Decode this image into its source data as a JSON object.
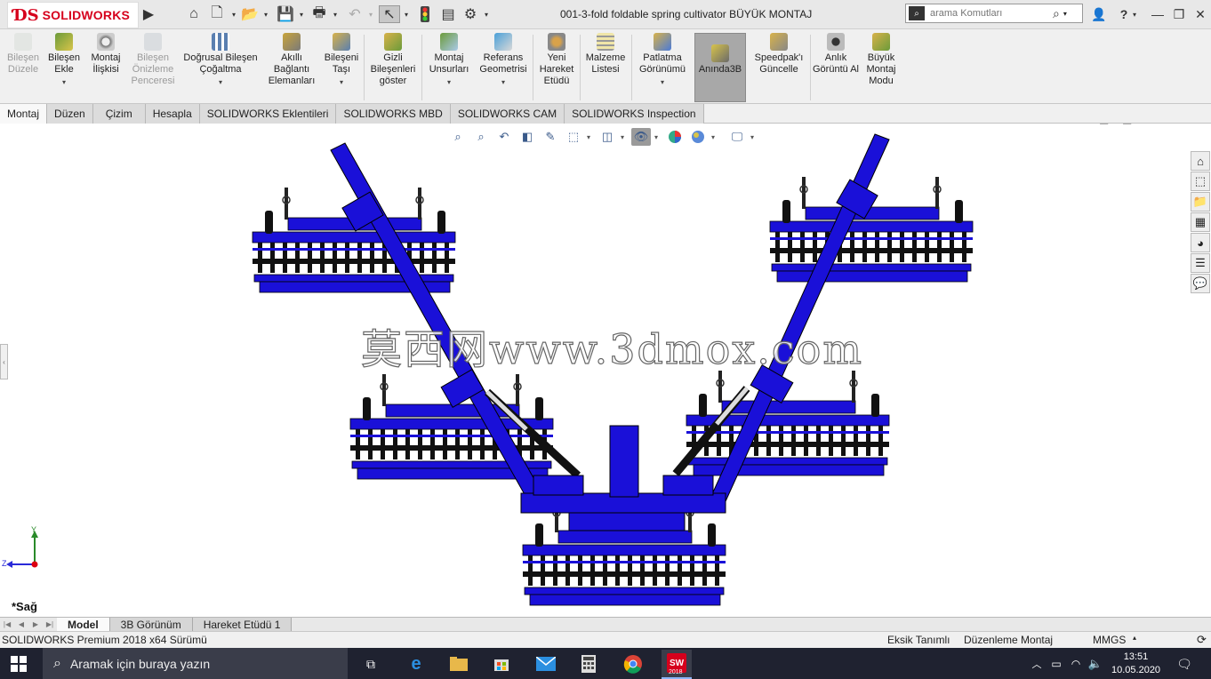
{
  "titlebar": {
    "brand": "SOLIDWORKS",
    "doc_title": "001-3-fold foldable spring cultivator BÜYÜK MONTAJ",
    "search_placeholder": "arama Komutları",
    "help_label": "?"
  },
  "ribbon": {
    "items": [
      {
        "label": "Bileşen Düzele",
        "enabled": false,
        "icon": "edit-component-icon"
      },
      {
        "label": "Bileşen Ekle",
        "enabled": true,
        "icon": "insert-component-icon"
      },
      {
        "label": "Montaj İlişkisi",
        "enabled": true,
        "icon": "mate-icon"
      },
      {
        "label": "Bileşen Önizleme Penceresi",
        "enabled": false,
        "icon": "component-preview-icon"
      },
      {
        "label": "Doğrusal Bileşen Çoğaltma",
        "enabled": true,
        "icon": "linear-pattern-icon"
      },
      {
        "label": "Akıllı Bağlantı Elemanları",
        "enabled": true,
        "icon": "smart-fasteners-icon"
      },
      {
        "label": "Bileşeni Taşı",
        "enabled": true,
        "icon": "move-component-icon"
      },
      {
        "label": "Gizli Bileşenleri göster",
        "enabled": true,
        "icon": "show-hidden-icon"
      },
      {
        "label": "Montaj Unsurları",
        "enabled": true,
        "icon": "assembly-features-icon"
      },
      {
        "label": "Referans Geometrisi",
        "enabled": true,
        "icon": "reference-geometry-icon"
      },
      {
        "label": "Yeni Hareket Etüdü",
        "enabled": true,
        "icon": "new-motion-study-icon"
      },
      {
        "label": "Malzeme Listesi",
        "enabled": true,
        "icon": "bill-of-materials-icon"
      },
      {
        "label": "Patlatma Görünümü",
        "enabled": true,
        "icon": "exploded-view-icon"
      },
      {
        "label": "Anında3B",
        "enabled": true,
        "icon": "instant3d-icon"
      },
      {
        "label": "Speedpak'ı Güncelle",
        "enabled": true,
        "icon": "speedpak-icon"
      },
      {
        "label": "Anlık Görüntü Al",
        "enabled": true,
        "icon": "snapshot-icon"
      },
      {
        "label": "Büyük Montaj Modu",
        "enabled": true,
        "icon": "large-assembly-icon"
      }
    ]
  },
  "command_tabs": [
    "Montaj",
    "Düzen",
    "Çizim",
    "Hesapla",
    "SOLIDWORKS Eklentileri",
    "SOLIDWORKS MBD",
    "SOLIDWORKS CAM",
    "SOLIDWORKS Inspection"
  ],
  "viewport": {
    "watermark": "莫西网www.3dmox.com",
    "view_label": "*Sağ",
    "axis_y": "Y",
    "axis_z": "Z"
  },
  "model_tabs": [
    "Model",
    "3B Görünüm",
    "Hareket Etüdü 1"
  ],
  "statusbar": {
    "version": "SOLIDWORKS Premium 2018 x64 Sürümü",
    "definition": "Eksik Tanımlı",
    "mode": "Düzenleme Montaj",
    "units": "MMGS"
  },
  "taskbar": {
    "search_placeholder": "Aramak için buraya yazın",
    "time": "13:51",
    "date": "10.05.2020",
    "sw_badge": "2018"
  },
  "colors": {
    "accent_red": "#d6001c",
    "model_blue": "#1a10d8",
    "taskbar": "#1f2230"
  }
}
